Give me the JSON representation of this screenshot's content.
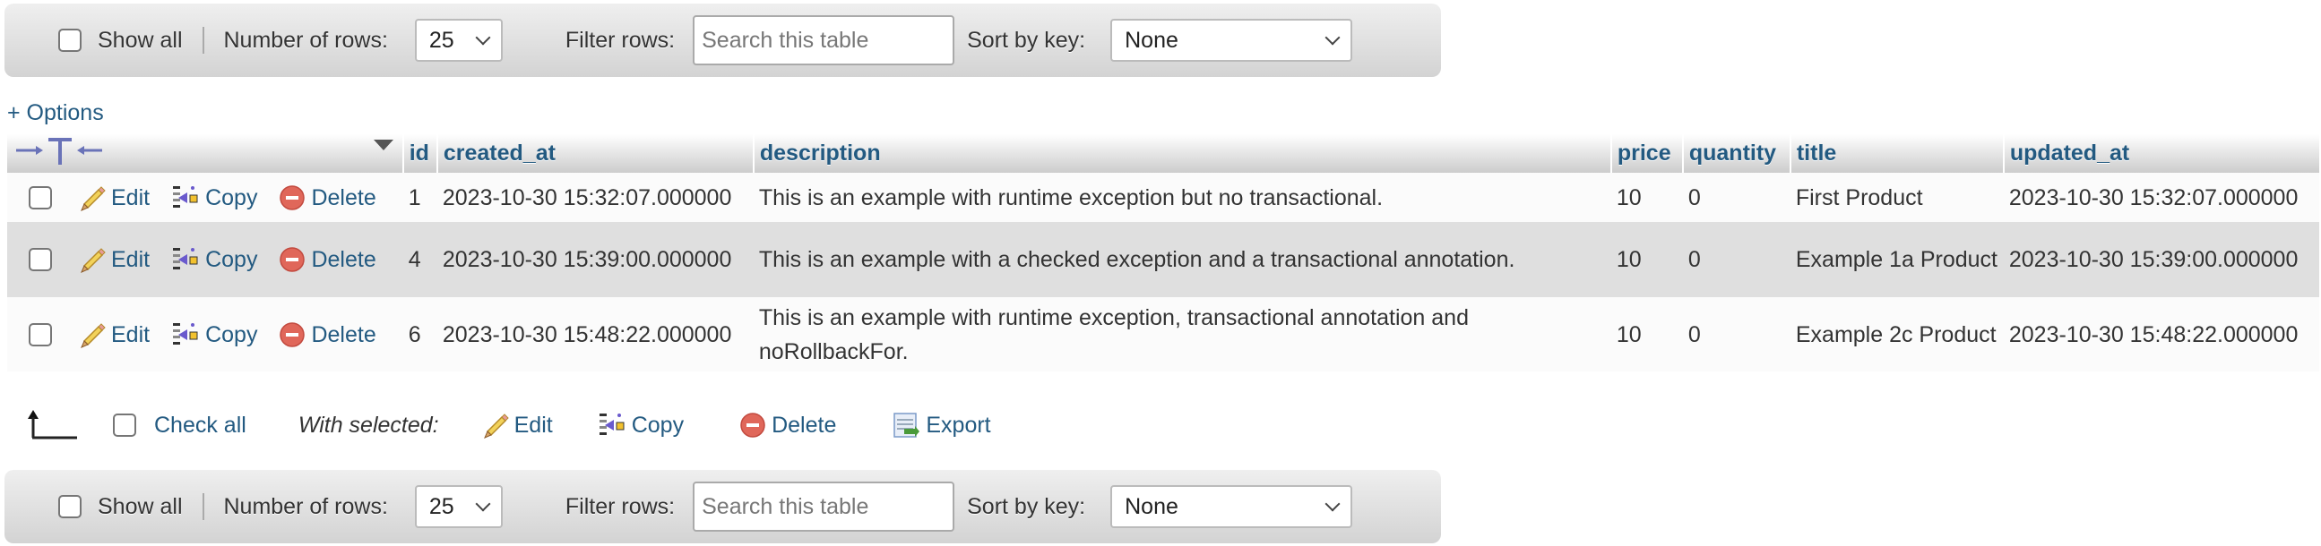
{
  "navigation": {
    "show_all_label": "Show all",
    "number_of_rows_label": "Number of rows:",
    "number_of_rows_value": "25",
    "filter_rows_label": "Filter rows:",
    "filter_placeholder": "Search this table",
    "filter_value": "",
    "sort_by_key_label": "Sort by key:",
    "sort_by_key_value": "None"
  },
  "options_link": "+ Options",
  "table": {
    "columns": [
      "id",
      "created_at",
      "description",
      "price",
      "quantity",
      "title",
      "updated_at"
    ],
    "row_actions": {
      "edit": "Edit",
      "copy": "Copy",
      "delete": "Delete"
    },
    "rows": [
      {
        "id": "1",
        "created_at": "2023-10-30 15:32:07.000000",
        "description": "This is an example with runtime exception but no transactional.",
        "price": "10",
        "quantity": "0",
        "title": "First Product",
        "updated_at": "2023-10-30 15:32:07.000000"
      },
      {
        "id": "4",
        "created_at": "2023-10-30 15:39:00.000000",
        "description": "This is an example with a checked exception and a transactional annotation.",
        "price": "10",
        "quantity": "0",
        "title": "Example 1a Product",
        "updated_at": "2023-10-30 15:39:00.000000"
      },
      {
        "id": "6",
        "created_at": "2023-10-30 15:48:22.000000",
        "description": "This is an example with runtime exception, transactional annotation and noRollbackFor.",
        "price": "10",
        "quantity": "0",
        "title": "Example 2c Product",
        "updated_at": "2023-10-30 15:48:22.000000"
      }
    ]
  },
  "bulk_actions": {
    "check_all_label": "Check all",
    "with_selected_label": "With selected:",
    "edit": "Edit",
    "copy": "Copy",
    "delete": "Delete",
    "export": "Export"
  },
  "colors": {
    "link": "#235a81",
    "row_alt": "#dfdfdf",
    "row": "#fbfbfb"
  }
}
